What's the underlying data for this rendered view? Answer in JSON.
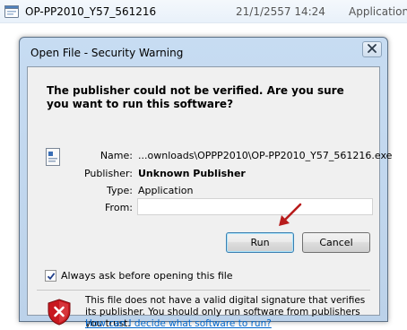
{
  "explorer_row": {
    "file_name": "OP-PP2010_Y57_561216",
    "date": "21/1/2557 14:24",
    "type": "Application"
  },
  "dialog": {
    "title": "Open File - Security Warning",
    "heading": "The publisher could not be verified.  Are you sure you want to run this software?",
    "fields": {
      "name_label": "Name:",
      "name_value": "...ownloads\\OPPP2010\\OP-PP2010_Y57_561216.exe",
      "publisher_label": "Publisher:",
      "publisher_value": "Unknown Publisher",
      "type_label": "Type:",
      "type_value": "Application",
      "from_label": "From:",
      "from_value": ""
    },
    "buttons": {
      "run": "Run",
      "cancel": "Cancel"
    },
    "checkbox": {
      "label": "Always ask before opening this file",
      "checked": true
    },
    "warning": {
      "text": "This file does not have a valid digital signature that verifies its publisher.  You should only run software from publishers you trust.",
      "link": "How can I decide what software to run?"
    }
  },
  "icons": {
    "explorer_file": "application-file-icon",
    "package": "package-icon",
    "close": "close-icon",
    "shield": "shield-error-icon",
    "arrow": "red-arrow-annotation"
  },
  "colors": {
    "title_bar": "#c7dcf2",
    "client_bg": "#f0f0f0",
    "link": "#0066cc",
    "shield_red": "#c8181f",
    "annotation_arrow": "#b81c1c"
  }
}
